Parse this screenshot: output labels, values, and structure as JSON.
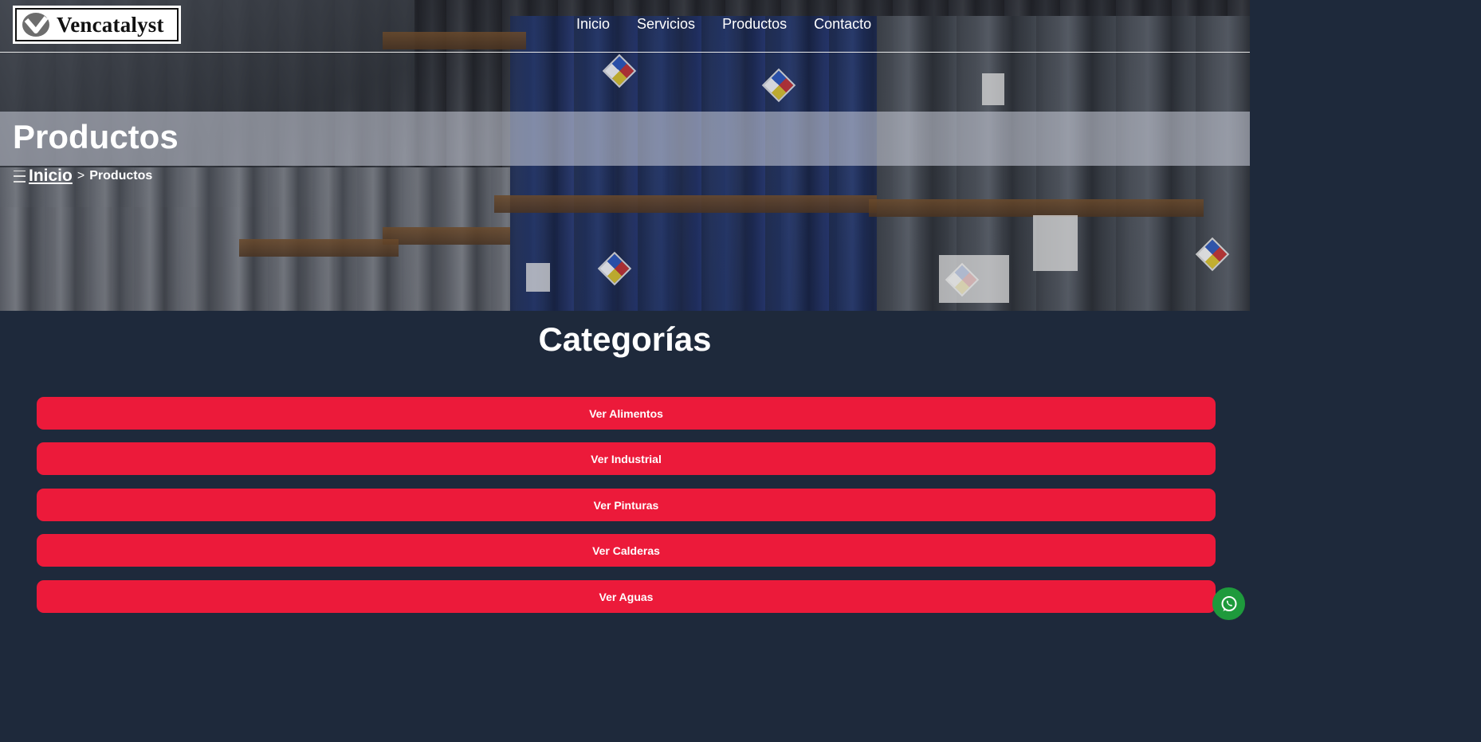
{
  "header": {
    "logo_text": "Vencatalyst",
    "nav": [
      {
        "label": "Inicio"
      },
      {
        "label": "Servicios"
      },
      {
        "label": "Productos"
      },
      {
        "label": "Contacto"
      }
    ]
  },
  "hero": {
    "title": "Productos",
    "breadcrumb": {
      "menu_icon": "menu-icon",
      "home": "Inicio",
      "separator": ">",
      "current": "Productos"
    }
  },
  "categories": {
    "title": "Categorías",
    "buttons": [
      {
        "label": "Ver Alimentos"
      },
      {
        "label": "Ver Industrial"
      },
      {
        "label": "Ver Pinturas"
      },
      {
        "label": "Ver Calderas"
      },
      {
        "label": "Ver Aguas"
      }
    ]
  },
  "floating": {
    "icon": "whatsapp-icon"
  },
  "colors": {
    "accent": "#ec1a3a",
    "background": "#1e293b",
    "whatsapp": "#1e9a3c"
  }
}
